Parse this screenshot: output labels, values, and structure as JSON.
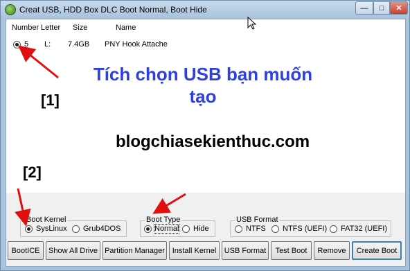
{
  "window": {
    "title": "Creat USB, HDD Box DLC Boot Normal, Boot Hide",
    "min_symbol": "—",
    "max_symbol": "□",
    "close_symbol": "✕"
  },
  "list": {
    "headers": [
      "Number",
      "Letter",
      "Size",
      "Name"
    ],
    "row": {
      "number": "5",
      "letter": "L:",
      "size": "7.4GB",
      "name": "PNY Hook Attache"
    }
  },
  "annotations": {
    "instruction_line1": "Tích chọn USB bạn muốn",
    "instruction_line2": "tạo",
    "marker1": "[1]",
    "marker2": "[2]",
    "watermark": "blogchiasekienthuc.com",
    "arrow_color": "#e01010"
  },
  "boot_kernel": {
    "label": "Boot Kernel",
    "options": [
      "SysLinux",
      "Grub4DOS"
    ],
    "selected": "SysLinux"
  },
  "boot_type": {
    "label": "Boot Type",
    "options": [
      "Normal",
      "Hide"
    ],
    "selected": "Normal"
  },
  "usb_format": {
    "label": "USB Format",
    "options": [
      "NTFS",
      "NTFS (UEFI)",
      "FAT32 (UEFI)"
    ]
  },
  "buttons": [
    "BootICE",
    "Show All Drive",
    "Partition Manager",
    "Install Kernel",
    "USB Format",
    "Test Boot",
    "Remove",
    "Create Boot"
  ]
}
